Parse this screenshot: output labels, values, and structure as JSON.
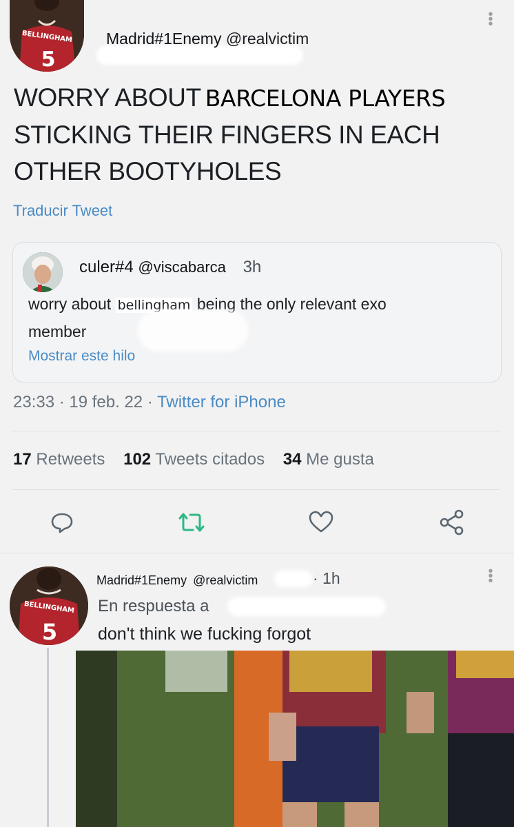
{
  "tweet": {
    "author_name": "Madrid#1Enemy",
    "author_handle": "@realvictim",
    "avatar_jersey_text": "BELLINGHAM",
    "avatar_jersey_number": "5",
    "text_part1": "WORRY ABOUT",
    "text_part2": "BARCELONA PLAYERS",
    "text_line2": "STICKING THEIR FINGERS IN EACH",
    "text_line3": "OTHER BOOTYHOLES",
    "translate_label": "Traducir Tweet",
    "timestamp": "23:33 · 19 feb. 22 ·",
    "source": "Twitter for iPhone",
    "stats": {
      "retweets_count": "17",
      "retweets_label": "Retweets",
      "quotes_count": "102",
      "quotes_label": "Tweets citados",
      "likes_count": "34",
      "likes_label": "Me gusta"
    }
  },
  "quoted": {
    "author_name": "culer#4",
    "author_handle": "@viscabarca",
    "time": "3h",
    "text_before": "worry about",
    "text_highlight": "bellingham",
    "text_after": "being the only relevant exo",
    "text_line2": "member",
    "show_thread": "Mostrar este hilo"
  },
  "reply": {
    "author_name": "Madrid#1Enemy",
    "author_handle": "@realvictim",
    "time": "· 1h",
    "replying_to": "En respuesta a",
    "text": "don't think we fucking forgot"
  },
  "colors": {
    "background": "#f2f2f2",
    "link": "#4a8bc4",
    "retweet_green": "#2fb884",
    "jersey_red": "#b3242c"
  },
  "icons": [
    "reply-icon",
    "retweet-icon",
    "like-icon",
    "share-icon",
    "more-icon"
  ]
}
